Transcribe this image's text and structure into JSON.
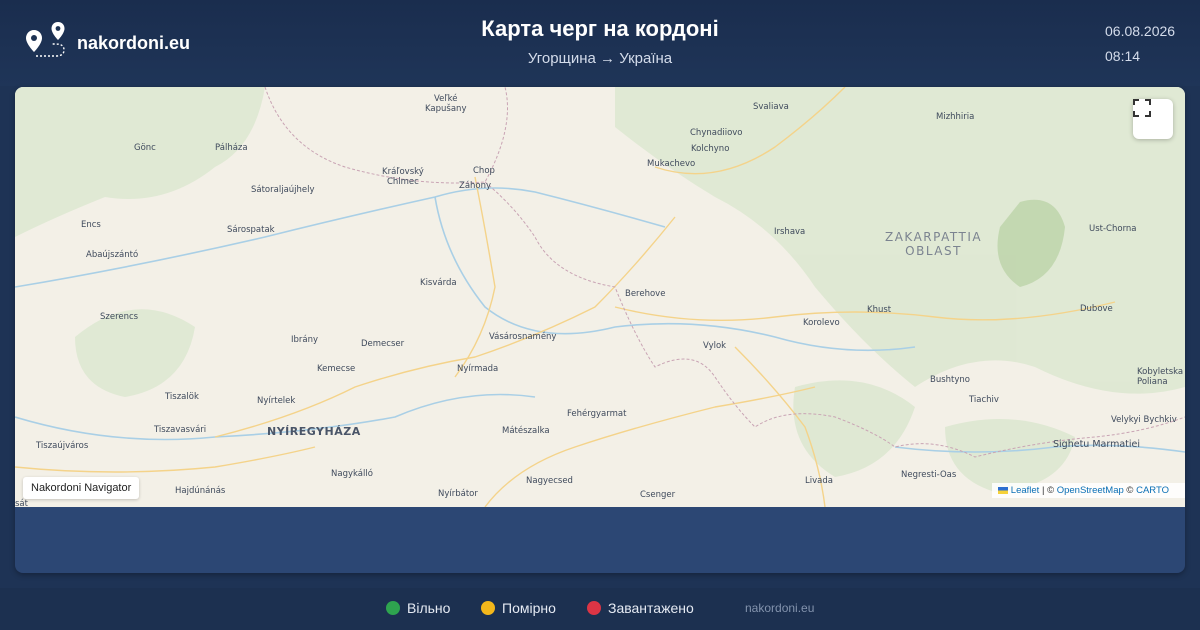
{
  "header": {
    "brand": "nakordoni.eu",
    "title": "Карта черг на кордоні",
    "subtitle": "Угорщина → Україна",
    "date": "06.08.2026",
    "time": "08:14"
  },
  "map": {
    "places": {
      "velke_kapusany": "Veľké\nKapušany",
      "svaliava": "Svaliava",
      "mizhhiria": "Mizhhiria",
      "chynadiiovo": "Chynadiiovo",
      "kolchyno": "Kolchyno",
      "mukachevo": "Mukachevo",
      "gonc": "Gönc",
      "palhaza": "Pálháza",
      "kralovsky": "Kráľovský\nChlmec",
      "chop": "Chop",
      "zahony": "Záhony",
      "satoraljaujhely": "Sátoraljaújhely",
      "encs": "Encs",
      "sarospatak": "Sárospatak",
      "irshava": "Irshava",
      "ust_chorna": "Ust-Chorna",
      "abaujszanto": "Abaújszántó",
      "kisvarda": "Kisvárda",
      "berehove": "Berehove",
      "khust": "Khust",
      "dubove": "Dubove",
      "szerencs": "Szerencs",
      "korolevo": "Korolevo",
      "vasarosnameny": "Vásárosnamény",
      "ibrany": "Ibrány",
      "demecser": "Demecser",
      "vylok": "Vylok",
      "kemecse": "Kemecse",
      "nyirmada": "Nyírmada",
      "bushtyno": "Bushtyno",
      "kobyletska": "Kobyletska\nPoliana",
      "tiszalok": "Tiszalök",
      "nyirtelek": "Nyírtelek",
      "tiachiv": "Tiachiv",
      "fehergyarmat": "Fehérgyarmat",
      "velykyi_bychkiv": "Velykyi Bychkiv",
      "tiszavasvari": "Tiszavasvári",
      "nyiregyhaza": "NYÍREGYHÁZA",
      "mateszalka": "Mátészalka",
      "tiszaujvaros": "Tiszaújváros",
      "sighetu": "Sighetu Marmatiei",
      "nagykallo": "Nagykálló",
      "negresti": "Negresti-Oas",
      "nagyecsed": "Nagyecsed",
      "livada": "Livada",
      "hajdunanas": "Hajdúnánás",
      "nyirbator": "Nyírbátor",
      "csenger": "Csenger",
      "region": "ZAKARPATTIA\nOBLAST",
      "cut_left": "sát"
    },
    "navigator_badge": "Nakordoni Navigator",
    "attribution": {
      "leaflet": "Leaflet",
      "sep1": " | © ",
      "osm": "OpenStreetMap",
      "sep2": " © ",
      "carto": "CARTO"
    }
  },
  "legend": [
    {
      "label": "Вільно",
      "color": "#2ea44f"
    },
    {
      "label": "Помірно",
      "color": "#f3b71b"
    },
    {
      "label": "Завантажено",
      "color": "#dc3545"
    }
  ],
  "footer": {
    "site": "nakordoni.eu"
  },
  "colors": {
    "accent_green": "#2ea44f",
    "accent_yellow": "#f3b71b",
    "accent_red": "#dc3545"
  }
}
